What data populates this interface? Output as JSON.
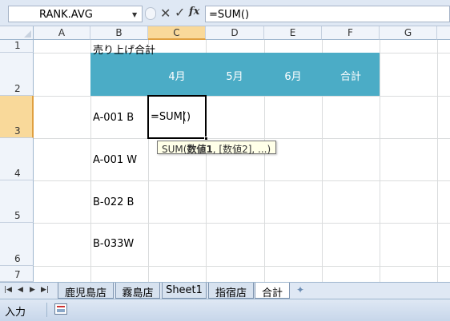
{
  "formula_bar": {
    "name_box": "RANK.AVG",
    "cancel_icon": "✕",
    "enter_icon": "✓",
    "fx_icon": "fx",
    "formula": "=SUM()"
  },
  "columns": [
    "A",
    "B",
    "C",
    "D",
    "E",
    "F",
    "G"
  ],
  "rows": [
    "1",
    "2",
    "3",
    "4",
    "5",
    "6",
    "7"
  ],
  "cells": {
    "B1": "売り上げ合計",
    "C2": "4月",
    "D2": "5月",
    "E2": "6月",
    "F2": "合計",
    "B3": "A-001 B",
    "B4": "A-001 W",
    "B5": "B-022 B",
    "B6": "B-033W",
    "C3": "=SUM()"
  },
  "tooltip": {
    "fn": "SUM(",
    "arg1": "数値1",
    "rest": ", [数値2], ...)"
  },
  "sheet_tabs": [
    "鹿児島店",
    "霧島店",
    "Sheet1",
    "指宿店",
    "合計"
  ],
  "active_tab": "合計",
  "status": {
    "mode": "入力"
  },
  "colors": {
    "band": "#4bacc6",
    "selected_header": "#f9d99a"
  }
}
